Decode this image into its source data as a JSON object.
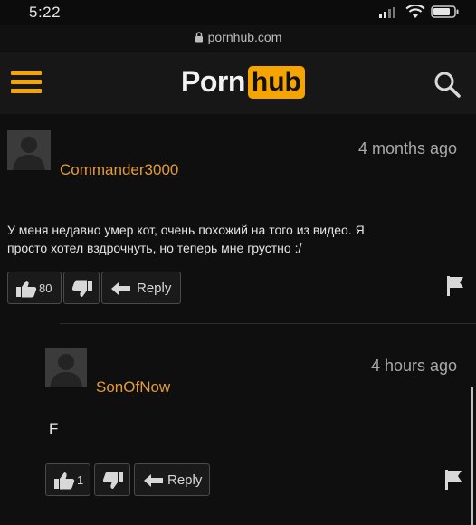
{
  "status_bar": {
    "time": "5:22"
  },
  "browser": {
    "url": "pornhub.com"
  },
  "header": {
    "logo_part1": "Porn",
    "logo_part2": "hub"
  },
  "comments": [
    {
      "username": "Commander3000",
      "time": "4 months ago",
      "text_line1": "У меня недавно умер кот, очень похожий на того из видео. Я",
      "text_line2": "просто хотел вздрочнуть, но теперь мне грустно :/",
      "likes": "80",
      "reply_label": "Reply"
    },
    {
      "username": "SonOfNow",
      "time": "4 hours ago",
      "text": "F",
      "likes": "1",
      "reply_label": "Reply"
    }
  ],
  "colors": {
    "accent": "#f6a400",
    "username": "#e39a38",
    "background": "#0f0f0f"
  }
}
